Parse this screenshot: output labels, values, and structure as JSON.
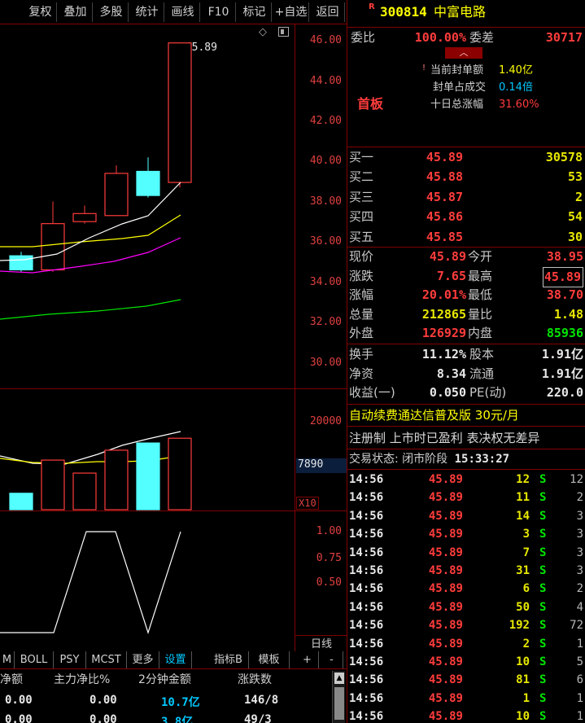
{
  "toolbar": {
    "items": [
      "复权",
      "叠加",
      "多股",
      "统计",
      "画线",
      "F10",
      "标记",
      "+自选",
      "返回"
    ]
  },
  "chart_data": {
    "type": "candlestick",
    "price_axis": [
      "46.00",
      "44.00",
      "42.00",
      "40.00",
      "38.00",
      "36.00",
      "34.00",
      "32.00",
      "30.00"
    ],
    "high_label": "45.89",
    "volume_axis": [
      "20000",
      "7890"
    ],
    "volume_unit": "X10",
    "indicator_axis": [
      "1.00",
      "0.75",
      "0.50"
    ],
    "period_label": "日线",
    "candles": [
      {
        "open": 34.6,
        "close": 35.3,
        "high": 35.5,
        "low": 34.5,
        "up": false
      },
      {
        "open": 34.6,
        "close": 36.9,
        "high": 38.0,
        "low": 34.5,
        "up": true
      },
      {
        "open": 37.0,
        "close": 37.4,
        "high": 37.8,
        "low": 36.9,
        "up": true
      },
      {
        "open": 37.3,
        "close": 39.4,
        "high": 39.8,
        "low": 37.3,
        "up": true
      },
      {
        "open": 39.5,
        "close": 38.3,
        "high": 40.2,
        "low": 38.2,
        "up": false
      },
      {
        "open": 38.95,
        "close": 45.89,
        "high": 45.89,
        "low": 38.7,
        "up": true
      }
    ],
    "volumes": [
      {
        "v": 0.48,
        "up": false
      },
      {
        "v": 1.45,
        "up": true
      },
      {
        "v": 1.07,
        "up": true
      },
      {
        "v": 1.74,
        "up": true
      },
      {
        "v": 1.95,
        "up": false
      },
      {
        "v": 2.09,
        "up": true
      }
    ]
  },
  "indicator_tabs": [
    "M",
    "BOLL",
    "PSY",
    "MCST",
    "更多",
    "设置",
    "指标B",
    "模板",
    "+",
    "-"
  ],
  "indicator_table": {
    "headers": [
      "净额",
      "主力净比%",
      "2分钟金额",
      "涨跌数"
    ],
    "row": [
      "0.00",
      "0.00",
      "10.7亿",
      "146/8"
    ],
    "row2": [
      "0.00",
      "0.00",
      "3.8亿",
      "49/3"
    ]
  },
  "stock": {
    "badge": "R",
    "code": "300814",
    "name": "中富电路"
  },
  "order_ratio": {
    "label": "委比",
    "value": "100.00%",
    "diff_label": "委差",
    "diff_value": "30717"
  },
  "limit_info": {
    "tag": "首板",
    "items": [
      {
        "label": "当前封单额",
        "value": "1.40亿"
      },
      {
        "label": "封单占成交",
        "value": "0.14倍"
      },
      {
        "label": "十日总涨幅",
        "value": "31.60%"
      }
    ]
  },
  "bids": [
    {
      "label": "买一",
      "price": "45.89",
      "vol": "30578"
    },
    {
      "label": "买二",
      "price": "45.88",
      "vol": "53"
    },
    {
      "label": "买三",
      "price": "45.87",
      "vol": "2"
    },
    {
      "label": "买四",
      "price": "45.86",
      "vol": "54"
    },
    {
      "label": "买五",
      "price": "45.85",
      "vol": "30"
    }
  ],
  "quote": [
    {
      "l1": "现价",
      "v1": "45.89",
      "l2": "今开",
      "v2": "38.95"
    },
    {
      "l1": "涨跌",
      "v1": "7.65",
      "l2": "最高",
      "v2": "45.89"
    },
    {
      "l1": "涨幅",
      "v1": "20.01%",
      "l2": "最低",
      "v2": "38.70"
    },
    {
      "l1": "总量",
      "v1": "212865",
      "l2": "量比",
      "v2": "1.48"
    },
    {
      "l1": "外盘",
      "v1": "126929",
      "l2": "内盘",
      "v2": "85936"
    }
  ],
  "fundamentals": [
    {
      "l1": "换手",
      "v1": "11.12%",
      "l2": "股本",
      "v2": "1.91亿"
    },
    {
      "l1": "净资",
      "v1": "8.34",
      "l2": "流通",
      "v2": "1.91亿"
    },
    {
      "l1": "收益(一)",
      "v1": "0.050",
      "l2": "PE(动)",
      "v2": "220.0"
    }
  ],
  "ad_text": "自动续费通达信普及版 30元/月",
  "notice_text": "注册制 上市时已盈利 表决权无差异",
  "trade_status": {
    "label": "交易状态: 闭市阶段",
    "time": "15:33:27"
  },
  "ticks": [
    {
      "t": "14:56",
      "p": "45.89",
      "v": "12",
      "s": "S",
      "n": "12"
    },
    {
      "t": "14:56",
      "p": "45.89",
      "v": "11",
      "s": "S",
      "n": "2"
    },
    {
      "t": "14:56",
      "p": "45.89",
      "v": "14",
      "s": "S",
      "n": "3"
    },
    {
      "t": "14:56",
      "p": "45.89",
      "v": "3",
      "s": "S",
      "n": "3"
    },
    {
      "t": "14:56",
      "p": "45.89",
      "v": "7",
      "s": "S",
      "n": "3"
    },
    {
      "t": "14:56",
      "p": "45.89",
      "v": "31",
      "s": "S",
      "n": "3"
    },
    {
      "t": "14:56",
      "p": "45.89",
      "v": "6",
      "s": "S",
      "n": "2"
    },
    {
      "t": "14:56",
      "p": "45.89",
      "v": "50",
      "s": "S",
      "n": "4"
    },
    {
      "t": "14:56",
      "p": "45.89",
      "v": "192",
      "s": "S",
      "n": "72"
    },
    {
      "t": "14:56",
      "p": "45.89",
      "v": "2",
      "s": "S",
      "n": "1"
    },
    {
      "t": "14:56",
      "p": "45.89",
      "v": "10",
      "s": "S",
      "n": "5"
    },
    {
      "t": "14:56",
      "p": "45.89",
      "v": "81",
      "s": "S",
      "n": "6"
    },
    {
      "t": "14:56",
      "p": "45.89",
      "v": "1",
      "s": "S",
      "n": "1"
    },
    {
      "t": "14:56",
      "p": "45.89",
      "v": "10",
      "s": "S",
      "n": "1"
    }
  ],
  "colors": {
    "up": "#ff3c3c",
    "down": "#54ffff",
    "grid": "#800000",
    "ma5": "#ffffff",
    "ma10": "#ffff00",
    "ma20": "#ff00ff",
    "ma60": "#00e600"
  }
}
